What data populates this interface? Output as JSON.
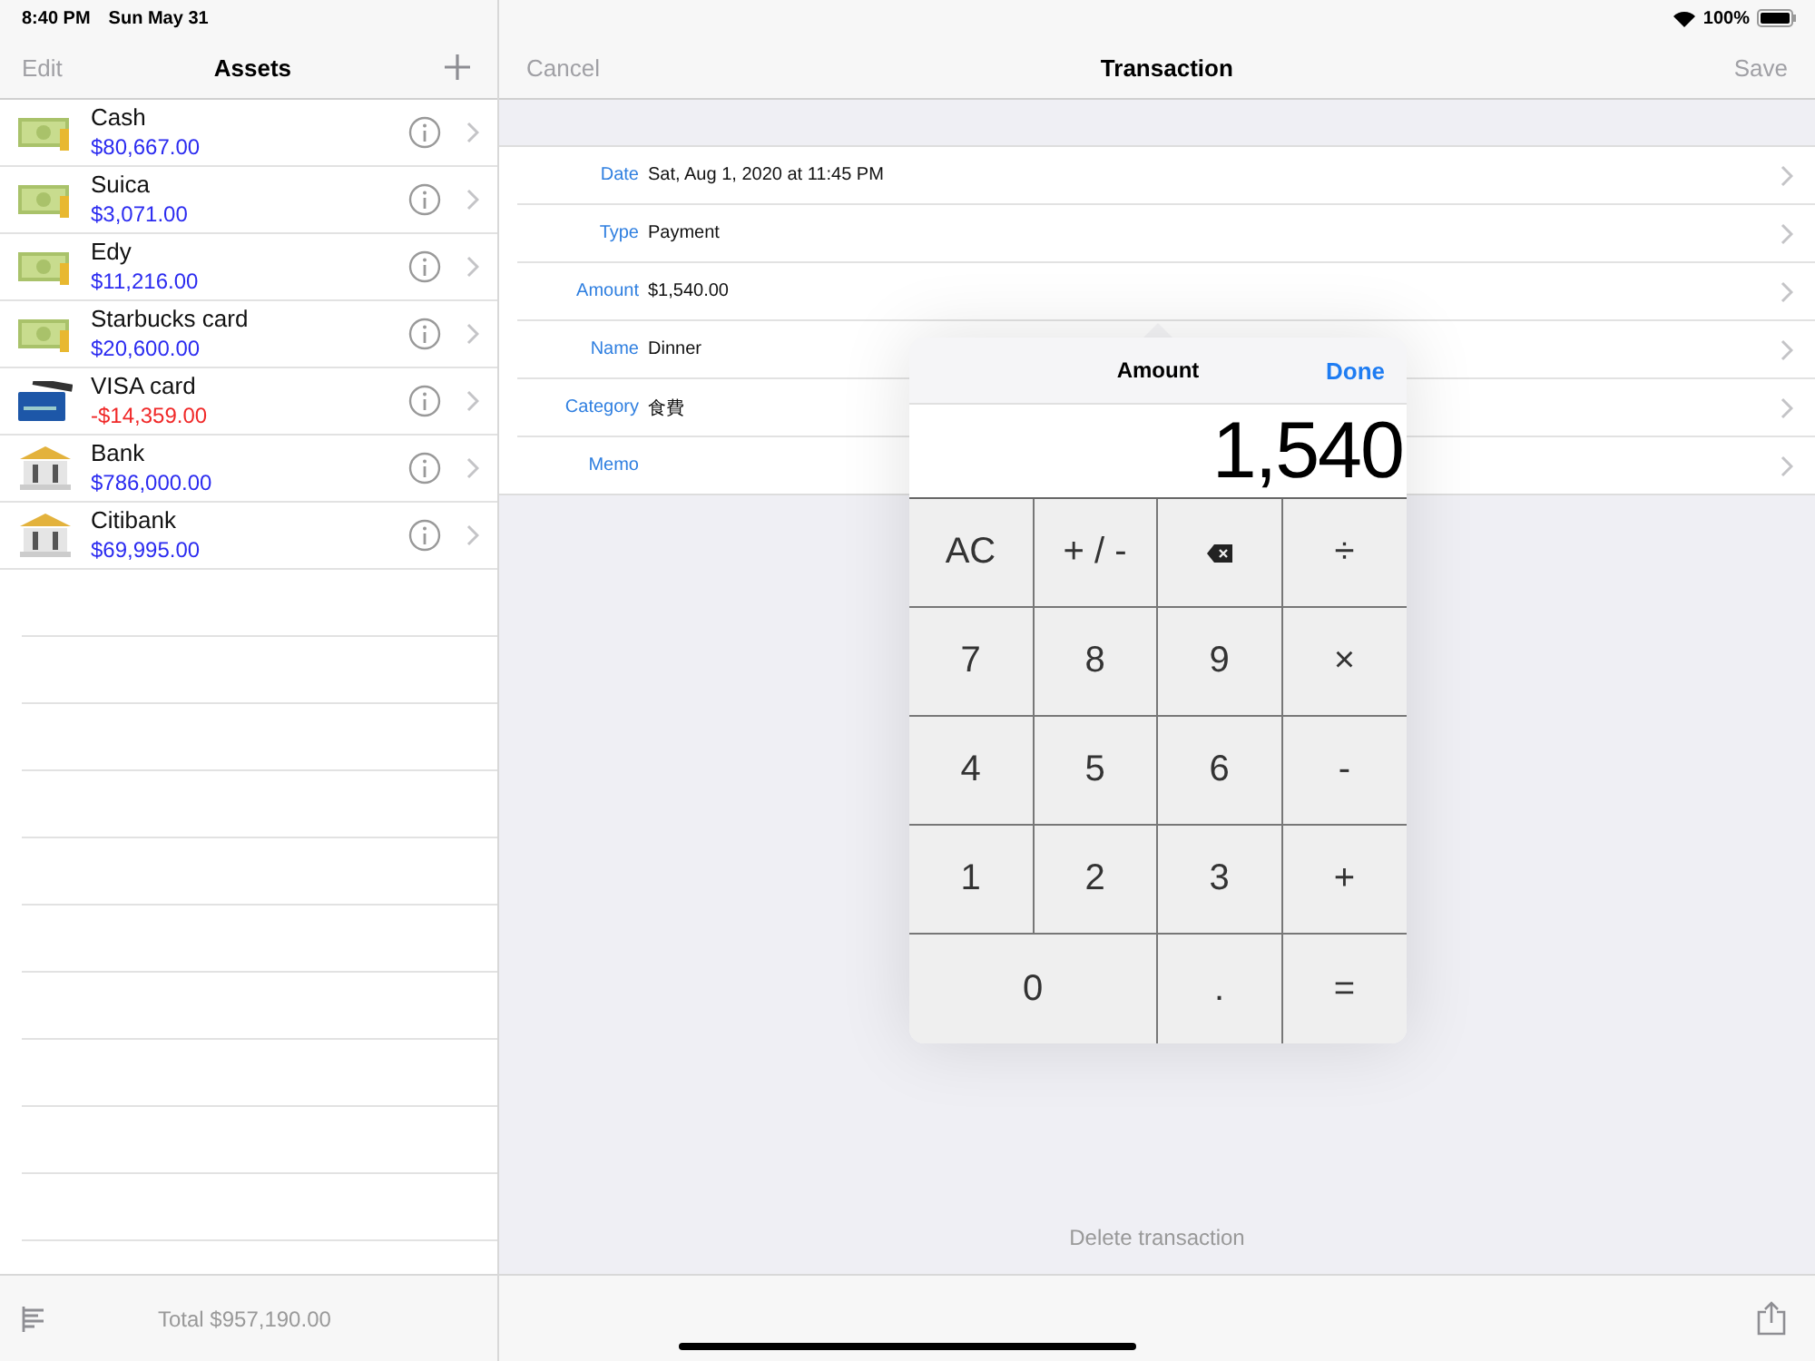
{
  "status_bar": {
    "time": "8:40 PM",
    "date": "Sun May 31",
    "battery": "100%"
  },
  "assets_panel": {
    "edit": "Edit",
    "title": "Assets",
    "items": [
      {
        "name": "Cash",
        "amount": "$80,667.00",
        "kind": "cash",
        "negative": false
      },
      {
        "name": "Suica",
        "amount": "$3,071.00",
        "kind": "cash",
        "negative": false
      },
      {
        "name": "Edy",
        "amount": "$11,216.00",
        "kind": "cash",
        "negative": false
      },
      {
        "name": "Starbucks card",
        "amount": "$20,600.00",
        "kind": "cash",
        "negative": false
      },
      {
        "name": "VISA card",
        "amount": "-$14,359.00",
        "kind": "card",
        "negative": true
      },
      {
        "name": "Bank",
        "amount": "$786,000.00",
        "kind": "bank",
        "negative": false
      },
      {
        "name": "Citibank",
        "amount": "$69,995.00",
        "kind": "bank",
        "negative": false
      }
    ],
    "total": "Total $957,190.00"
  },
  "transaction": {
    "cancel": "Cancel",
    "title": "Transaction",
    "save": "Save",
    "fields": [
      {
        "label": "Date",
        "value": "Sat, Aug 1, 2020 at 11:45 PM"
      },
      {
        "label": "Type",
        "value": "Payment"
      },
      {
        "label": "Amount",
        "value": "$1,540.00"
      },
      {
        "label": "Name",
        "value": "Dinner"
      },
      {
        "label": "Category",
        "value": "食費"
      },
      {
        "label": "Memo"
      }
    ],
    "delete": "Delete transaction"
  },
  "calculator": {
    "title": "Amount",
    "done": "Done",
    "display": "1,540",
    "keys": [
      {
        "label": "AC",
        "kind": "text",
        "wide": false
      },
      {
        "label": "+ / -",
        "kind": "text",
        "wide": false
      },
      {
        "kind": "backspace",
        "wide": false
      },
      {
        "label": "÷",
        "kind": "text",
        "wide": false
      },
      {
        "label": "7",
        "kind": "text",
        "wide": false
      },
      {
        "label": "8",
        "kind": "text",
        "wide": false
      },
      {
        "label": "9",
        "kind": "text",
        "wide": false
      },
      {
        "label": "×",
        "kind": "text",
        "wide": false
      },
      {
        "label": "4",
        "kind": "text",
        "wide": false
      },
      {
        "label": "5",
        "kind": "text",
        "wide": false
      },
      {
        "label": "6",
        "kind": "text",
        "wide": false
      },
      {
        "label": "-",
        "kind": "text",
        "wide": false
      },
      {
        "label": "1",
        "kind": "text",
        "wide": false
      },
      {
        "label": "2",
        "kind": "text",
        "wide": false
      },
      {
        "label": "3",
        "kind": "text",
        "wide": false
      },
      {
        "label": "+",
        "kind": "text",
        "wide": false
      },
      {
        "label": "0",
        "kind": "text",
        "wide": true
      },
      {
        "label": ".",
        "kind": "text",
        "wide": false
      },
      {
        "label": "=",
        "kind": "text",
        "wide": false
      }
    ]
  }
}
